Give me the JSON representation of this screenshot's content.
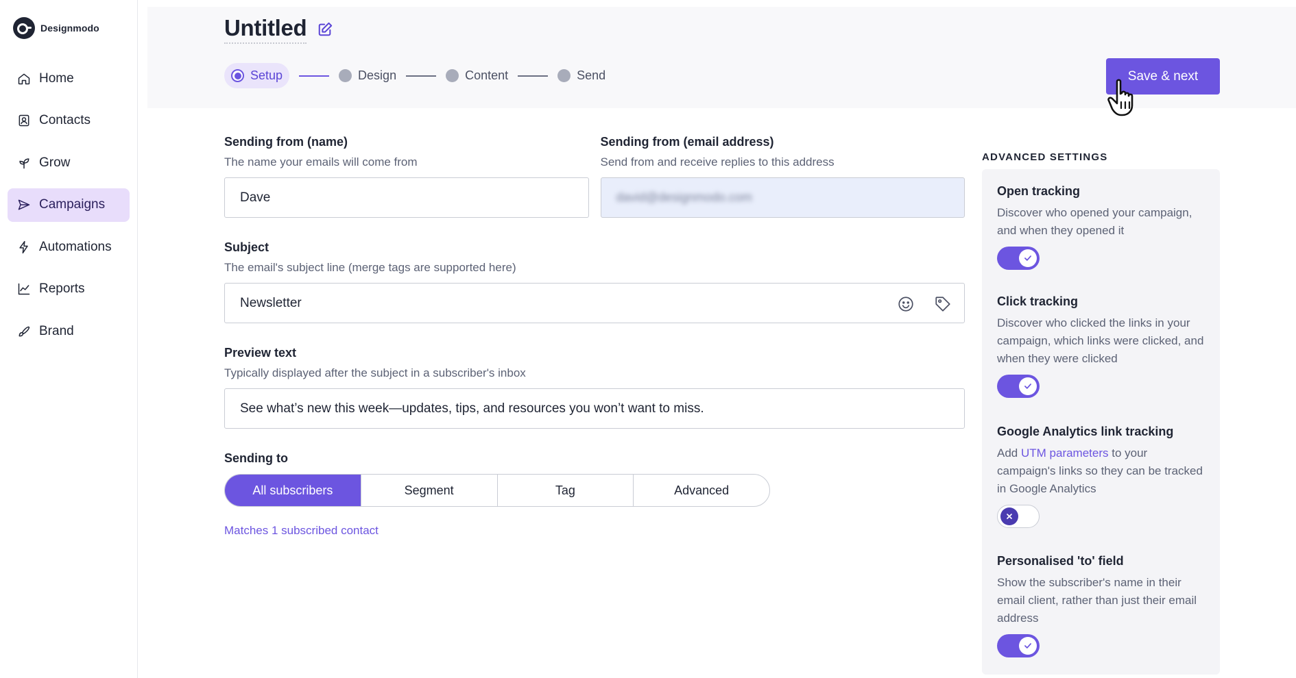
{
  "app": {
    "logo_text": "Designmodo"
  },
  "sidebar": {
    "items": [
      {
        "label": "Home",
        "icon": "home-icon"
      },
      {
        "label": "Contacts",
        "icon": "contacts-icon"
      },
      {
        "label": "Grow",
        "icon": "sprout-icon"
      },
      {
        "label": "Campaigns",
        "icon": "send-icon",
        "active": true
      },
      {
        "label": "Automations",
        "icon": "lightning-icon"
      },
      {
        "label": "Reports",
        "icon": "chart-icon"
      },
      {
        "label": "Brand",
        "icon": "brush-icon"
      }
    ]
  },
  "header": {
    "title": "Untitled",
    "steps": [
      "Setup",
      "Design",
      "Content",
      "Send"
    ],
    "active_step": "Setup",
    "save_label": "Save & next"
  },
  "form": {
    "from_name": {
      "label": "Sending from (name)",
      "hint": "The name your emails will come from",
      "value": "Dave"
    },
    "from_email": {
      "label": "Sending from (email address)",
      "hint": "Send from and receive replies to this address",
      "value": "david@designmodo.com"
    },
    "subject": {
      "label": "Subject",
      "hint": "The email's subject line (merge tags are supported here)",
      "value": "Newsletter"
    },
    "preview": {
      "label": "Preview text",
      "hint": "Typically displayed after the subject in a subscriber's inbox",
      "value": "See what’s new this week—updates, tips, and resources you won’t want to miss."
    },
    "sending_to": {
      "label": "Sending to",
      "options": [
        "All subscribers",
        "Segment",
        "Tag",
        "Advanced"
      ],
      "selected": "All subscribers",
      "matches": "Matches 1 subscribed contact"
    }
  },
  "advanced": {
    "heading": "ADVANCED SETTINGS",
    "open_tracking": {
      "title": "Open tracking",
      "desc": "Discover who opened your campaign, and when they opened it",
      "enabled": true
    },
    "click_tracking": {
      "title": "Click tracking",
      "desc": "Discover who clicked the links in your campaign, which links were clicked, and when they were clicked",
      "enabled": true
    },
    "ga_tracking": {
      "title": "Google Analytics link tracking",
      "desc_before": "Add ",
      "desc_link": "UTM parameters",
      "desc_after": " to your campaign's links so they can be tracked in Google Analytics",
      "enabled": false
    },
    "personalised_to": {
      "title": "Personalised 'to' field",
      "desc": "Show the subscriber's name in their email client, rather than just their email address",
      "enabled": true
    }
  },
  "colors": {
    "accent": "#6c55e0",
    "active_nav_bg": "#e8ddfb"
  }
}
